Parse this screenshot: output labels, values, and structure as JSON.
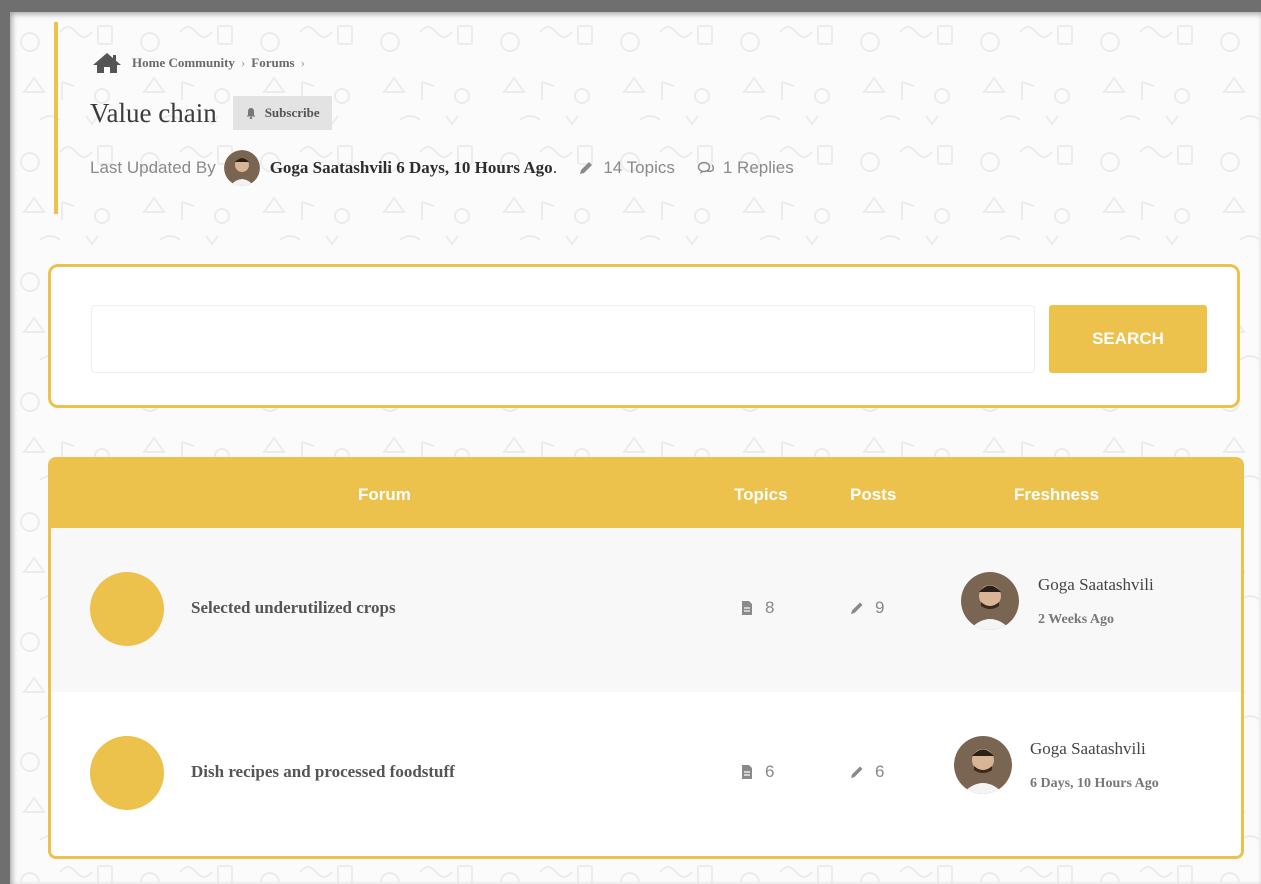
{
  "breadcrumb": {
    "items": [
      "Home Community",
      "Forums"
    ],
    "separator": "›"
  },
  "page": {
    "title": "Value chain",
    "subscribe_label": "Subscribe"
  },
  "meta": {
    "prefix": "Last Updated By",
    "author": "Goga Saatashvili 6 Days, 10 Hours Ago",
    "author_suffix": ".",
    "topics": "14 Topics",
    "replies": "1 Replies"
  },
  "search": {
    "placeholder": "",
    "button_label": "SEARCH"
  },
  "table": {
    "headers": {
      "forum": "Forum",
      "topics": "Topics",
      "posts": "Posts",
      "freshness": "Freshness"
    },
    "rows": [
      {
        "name": "Selected underutilized crops",
        "topics": "8",
        "posts": "9",
        "fresh_author": "Goga Saatashvili",
        "fresh_time": "2 Weeks Ago"
      },
      {
        "name": "Dish recipes and processed foodstuff",
        "topics": "6",
        "posts": "6",
        "fresh_author": "Goga Saatashvili",
        "fresh_time": "6 Days, 10 Hours Ago"
      }
    ]
  },
  "colors": {
    "accent": "#ecc14c",
    "header_text": "#ffffff",
    "background": "#fbfbfb"
  },
  "icons": [
    "home-icon",
    "bell-icon",
    "avatar",
    "pencil-icon",
    "replies-icon",
    "document-icon"
  ]
}
